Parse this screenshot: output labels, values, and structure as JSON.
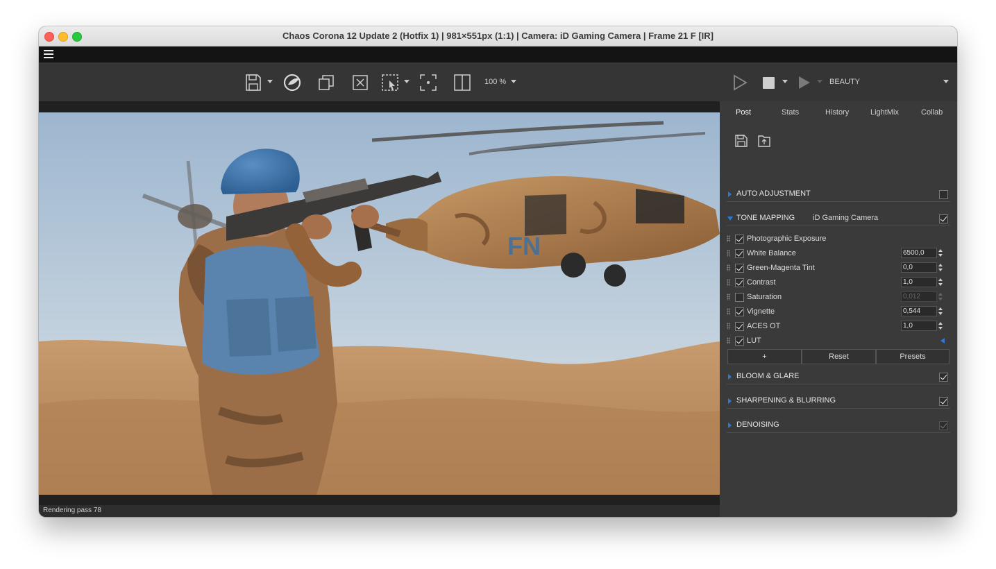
{
  "window": {
    "title": "Chaos Corona 12 Update 2 (Hotfix 1) | 981×551px (1:1) | Camera: iD Gaming Camera | Frame 21 F [IR]"
  },
  "toolbar": {
    "zoom": "100 %",
    "channel": "BEAUTY",
    "icons": [
      "save-icon",
      "corona-logo-icon",
      "copy-icon",
      "clear-icon",
      "region-select-icon",
      "focus-point-icon",
      "compare-split-icon",
      "play-icon",
      "stop-icon",
      "resume-icon"
    ]
  },
  "status": {
    "text": "Rendering pass 78"
  },
  "panel": {
    "tabs": [
      {
        "label": "Post",
        "active": true
      },
      {
        "label": "Stats"
      },
      {
        "label": "History"
      },
      {
        "label": "LightMix"
      },
      {
        "label": "Collab"
      }
    ],
    "sections": {
      "auto_adjustment": {
        "label": "AUTO ADJUSTMENT",
        "checked": false
      },
      "tone_mapping": {
        "label": "TONE MAPPING",
        "preset": "iD Gaming Camera",
        "checked": true
      },
      "bloom": {
        "label": "BLOOM & GLARE",
        "checked": true
      },
      "sharpening": {
        "label": "SHARPENING & BLURRING",
        "checked": true
      },
      "denoising": {
        "label": "DENOISING",
        "checked": true,
        "disabled": true
      }
    },
    "operators": [
      {
        "label": "Photographic Exposure",
        "checked": true
      },
      {
        "label": "White Balance",
        "checked": true,
        "value": "6500,0"
      },
      {
        "label": "Green-Magenta Tint",
        "checked": true,
        "value": "0,0"
      },
      {
        "label": "Contrast",
        "checked": true,
        "value": "1,0"
      },
      {
        "label": "Saturation",
        "checked": false,
        "value": "0,012"
      },
      {
        "label": "Vignette",
        "checked": true,
        "value": "0,544"
      },
      {
        "label": "ACES OT",
        "checked": true,
        "value": "1,0"
      },
      {
        "label": "LUT",
        "checked": true
      }
    ],
    "buttons": {
      "add": "+",
      "reset": "Reset",
      "presets": "Presets"
    }
  },
  "colors": {
    "accent": "#2e7bd6",
    "panel_bg": "#3a3a3a",
    "toolbar_bg": "#353535",
    "menubar_bg": "#141414"
  }
}
